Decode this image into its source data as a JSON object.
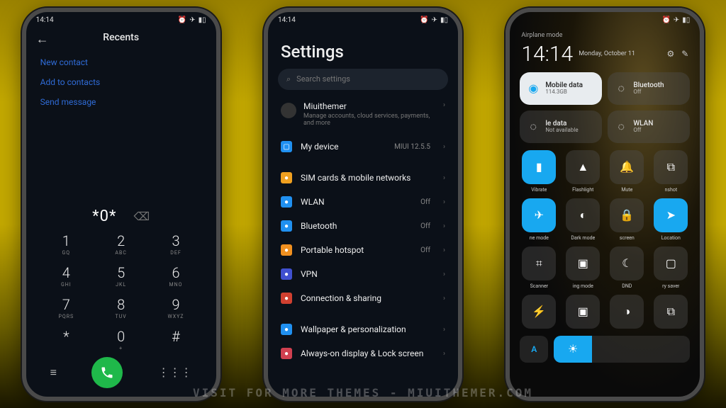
{
  "statusbar": {
    "time": "14:14"
  },
  "phone1": {
    "title": "Recents",
    "links": [
      "New contact",
      "Add to contacts",
      "Send message"
    ],
    "dialed": "*0*",
    "keys": [
      {
        "d": "1",
        "l": "GQ"
      },
      {
        "d": "2",
        "l": "ABC"
      },
      {
        "d": "3",
        "l": "DEF"
      },
      {
        "d": "4",
        "l": "GHI"
      },
      {
        "d": "5",
        "l": "JKL"
      },
      {
        "d": "6",
        "l": "MNO"
      },
      {
        "d": "7",
        "l": "PQRS"
      },
      {
        "d": "8",
        "l": "TUV"
      },
      {
        "d": "9",
        "l": "WXYZ"
      },
      {
        "d": "*",
        "l": ""
      },
      {
        "d": "0",
        "l": "+"
      },
      {
        "d": "#",
        "l": ""
      }
    ]
  },
  "phone2": {
    "title": "Settings",
    "search_placeholder": "Search settings",
    "account": {
      "name": "Miuithemer",
      "sub": "Manage accounts, cloud services, payments, and more"
    },
    "device": {
      "label": "My device",
      "value": "MIUI 12.5.5"
    },
    "rows": [
      {
        "icon": "#f0a020",
        "name": "sim-icon",
        "label": "SIM cards & mobile networks",
        "value": ""
      },
      {
        "icon": "#2090f0",
        "name": "wifi-icon",
        "label": "WLAN",
        "value": "Off"
      },
      {
        "icon": "#2090f0",
        "name": "bluetooth-icon",
        "label": "Bluetooth",
        "value": "Off"
      },
      {
        "icon": "#f09020",
        "name": "hotspot-icon",
        "label": "Portable hotspot",
        "value": "Off"
      },
      {
        "icon": "#4050d0",
        "name": "vpn-icon",
        "label": "VPN",
        "value": ""
      },
      {
        "icon": "#d04030",
        "name": "connection-icon",
        "label": "Connection & sharing",
        "value": ""
      }
    ],
    "rows2": [
      {
        "icon": "#2090f0",
        "name": "wallpaper-icon",
        "label": "Wallpaper & personalization",
        "value": ""
      },
      {
        "icon": "#d04050",
        "name": "aod-icon",
        "label": "Always-on display & Lock screen",
        "value": ""
      }
    ]
  },
  "phone3": {
    "sub": "Airplane mode",
    "time": "14:14",
    "date": "Monday, October 11",
    "tiles": [
      {
        "name": "Mobile data",
        "sub": "114.3GB",
        "active": true,
        "icon": "drop-icon"
      },
      {
        "name": "Bluetooth",
        "sub": "Off",
        "active": false,
        "icon": "bluetooth-icon"
      },
      {
        "name": "le data",
        "sub": "Not available",
        "active": false,
        "icon": "data-icon"
      },
      {
        "name": "WLAN",
        "sub": "Off",
        "active": false,
        "icon": "wifi-icon"
      }
    ],
    "quick": [
      {
        "label": "Vibrate",
        "on": true,
        "icon": "vibrate-icon",
        "g": "▮"
      },
      {
        "label": "Flashlight",
        "on": false,
        "icon": "flashlight-icon",
        "g": "▲"
      },
      {
        "label": "Mute",
        "on": false,
        "icon": "mute-icon",
        "g": "🔔"
      },
      {
        "label": "nshot",
        "on": false,
        "icon": "screenshot-icon",
        "g": "⧉"
      },
      {
        "label": "ne mode",
        "on": true,
        "icon": "airplane-icon",
        "g": "✈"
      },
      {
        "label": "Dark mode",
        "on": false,
        "icon": "darkmode-icon",
        "g": "◐"
      },
      {
        "label": "screen",
        "on": false,
        "icon": "lock-icon",
        "g": "🔒"
      },
      {
        "label": "Location",
        "on": true,
        "icon": "location-icon",
        "g": "➤"
      },
      {
        "label": "Scanner",
        "on": false,
        "icon": "scanner-icon",
        "g": "⌗"
      },
      {
        "label": "ing mode",
        "on": false,
        "icon": "reading-icon",
        "g": "▣"
      },
      {
        "label": "DND",
        "on": false,
        "icon": "dnd-icon",
        "g": "☾"
      },
      {
        "label": "ry saver",
        "on": false,
        "icon": "battery-icon",
        "g": "▢"
      }
    ],
    "extra": [
      {
        "icon": "power-icon",
        "g": "⚡"
      },
      {
        "icon": "cast-icon",
        "g": "▣"
      },
      {
        "icon": "invert-icon",
        "g": "◑"
      },
      {
        "icon": "float-icon",
        "g": "⧉"
      }
    ],
    "auto_label": "A"
  },
  "watermark": "VISIT FOR MORE THEMES - MIUITHEMER.COM"
}
